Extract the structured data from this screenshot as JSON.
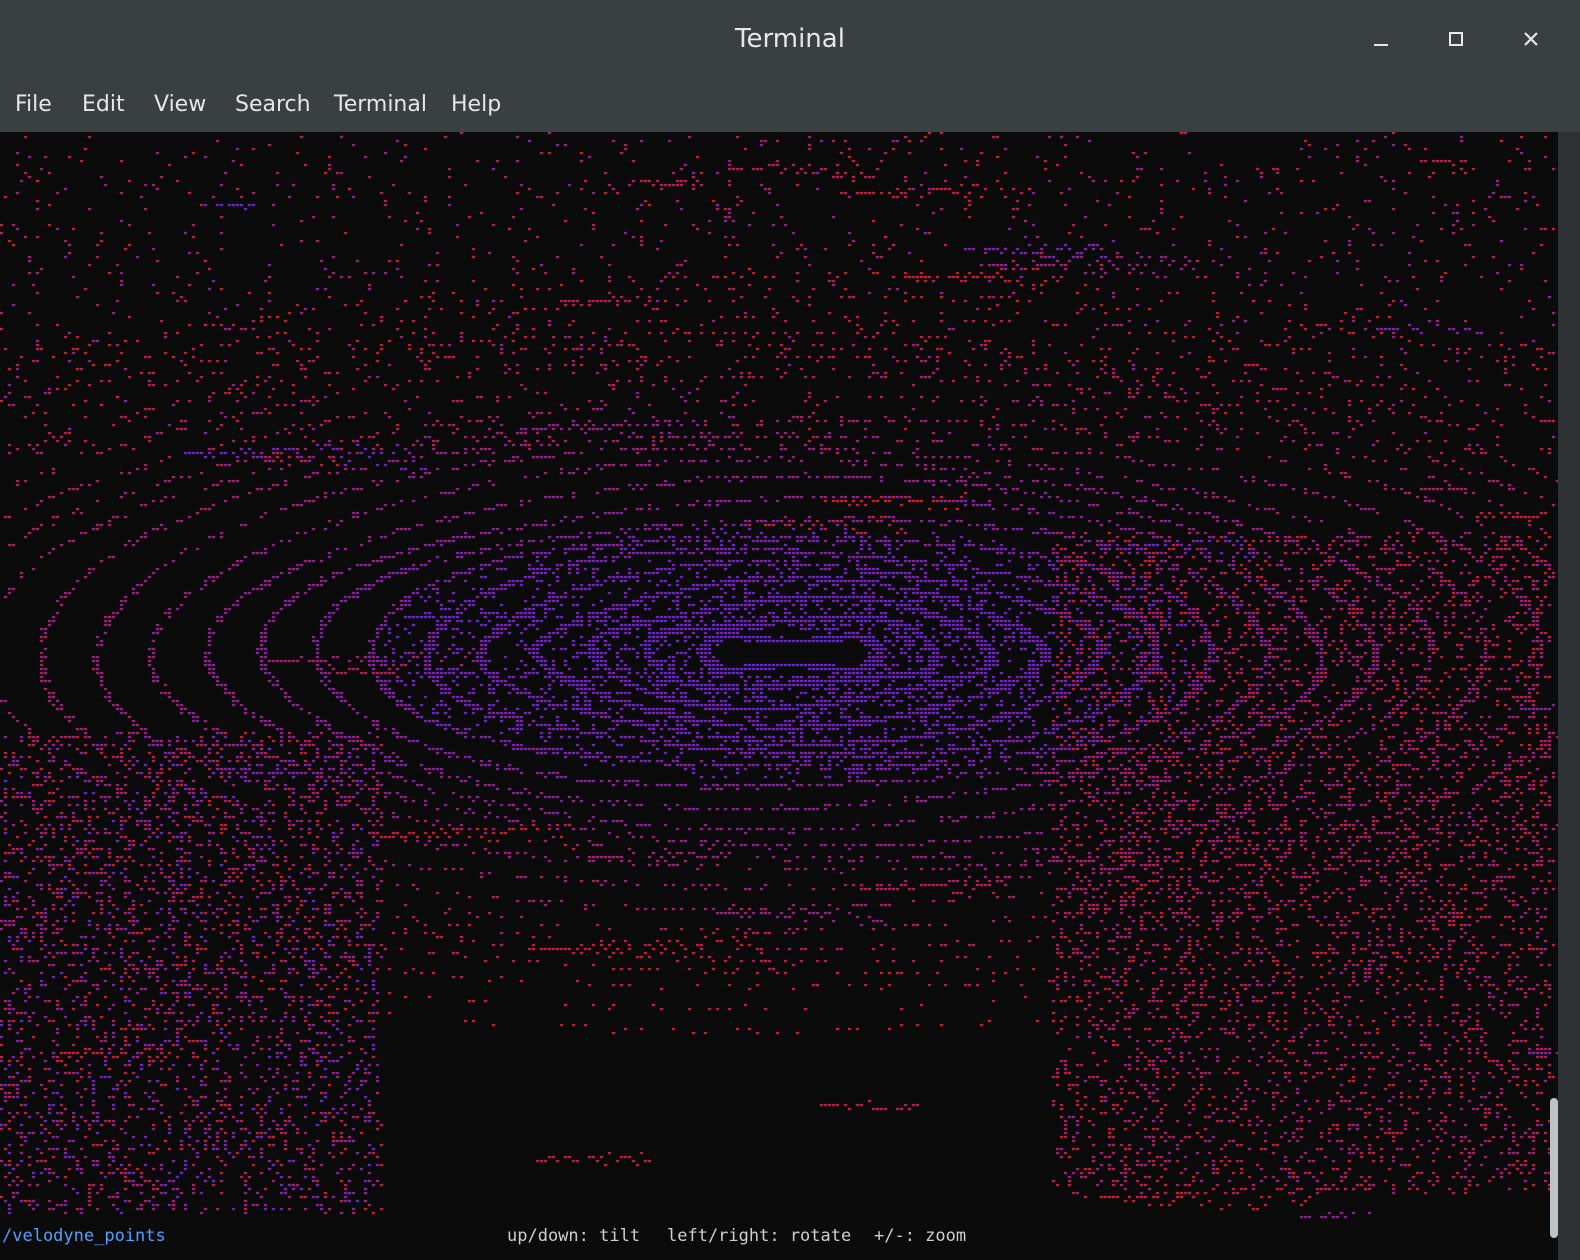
{
  "window": {
    "title": "Terminal",
    "controls": {
      "minimize": "minimize-icon",
      "maximize": "maximize-icon",
      "close": "close-icon"
    }
  },
  "menu": {
    "items": [
      {
        "label": "File"
      },
      {
        "label": "Edit"
      },
      {
        "label": "View"
      },
      {
        "label": "Search"
      },
      {
        "label": "Terminal"
      },
      {
        "label": "Help"
      }
    ]
  },
  "terminal": {
    "topic": "/velodyne_points",
    "hints": {
      "tilt": "up/down: tilt",
      "rotate": "left/right: rotate",
      "zoom": "+/-: zoom"
    },
    "colors": {
      "background": "#0b0b0c",
      "near": "#7a2cff",
      "far": "#ff1f2d",
      "topic": "#4aa3ff",
      "hint": "#cfcfcf"
    }
  },
  "scrollbar": {
    "position_fraction": 0.95
  }
}
